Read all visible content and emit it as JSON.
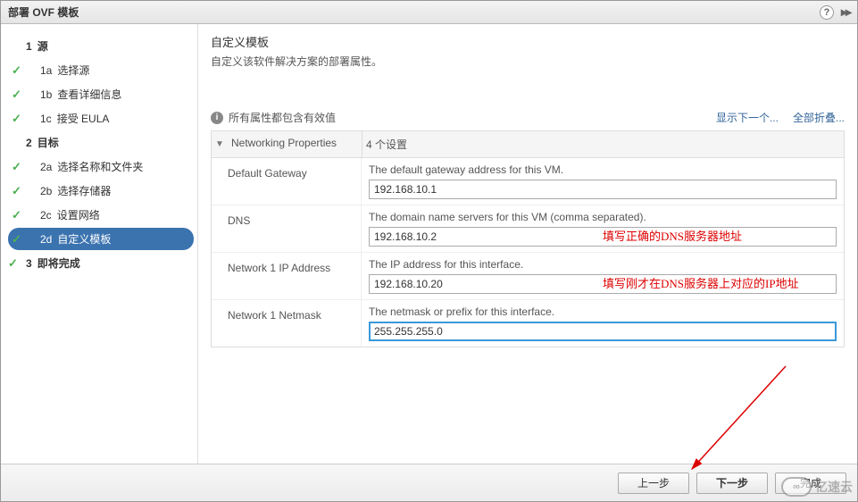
{
  "title": "部署 OVF 模板",
  "sidebar": {
    "sections": [
      {
        "idx": "1",
        "label": "源",
        "done": false,
        "children": [
          {
            "idx": "1a",
            "label": "选择源",
            "done": true
          },
          {
            "idx": "1b",
            "label": "查看详细信息",
            "done": true
          },
          {
            "idx": "1c",
            "label": "接受 EULA",
            "done": true
          }
        ]
      },
      {
        "idx": "2",
        "label": "目标",
        "done": false,
        "children": [
          {
            "idx": "2a",
            "label": "选择名称和文件夹",
            "done": true
          },
          {
            "idx": "2b",
            "label": "选择存储器",
            "done": true
          },
          {
            "idx": "2c",
            "label": "设置网络",
            "done": true
          },
          {
            "idx": "2d",
            "label": "自定义模板",
            "done": true,
            "active": true
          }
        ]
      },
      {
        "idx": "3",
        "label": "即将完成",
        "done": true,
        "children": []
      }
    ]
  },
  "content": {
    "title": "自定义模板",
    "subtitle": "自定义该软件解决方案的部署属性。",
    "info_msg": "所有属性都包含有效值",
    "links": {
      "show_next": "显示下一个...",
      "collapse_all": "全部折叠..."
    },
    "group": {
      "name": "Networking Properties",
      "count": "4 个设置"
    },
    "rows": [
      {
        "label": "Default Gateway",
        "desc": "The default gateway address for this VM.",
        "value": "192.168.10.1",
        "annot": ""
      },
      {
        "label": "DNS",
        "desc": "The domain name servers for this VM (comma separated).",
        "value": "192.168.10.2",
        "annot": "填写正确的DNS服务器地址"
      },
      {
        "label": "Network 1 IP Address",
        "desc": "The IP address for this interface.",
        "value": "192.168.10.20",
        "annot": "填写刚才在DNS服务器上对应的IP地址"
      },
      {
        "label": "Network 1 Netmask",
        "desc": "The netmask or prefix for this interface.",
        "value": "255.255.255.0",
        "annot": "",
        "focused": true
      }
    ]
  },
  "footer": {
    "back": "上一步",
    "next": "下一步",
    "finish": "完成"
  },
  "watermark": {
    "icon": "∞",
    "text": "亿速云"
  }
}
